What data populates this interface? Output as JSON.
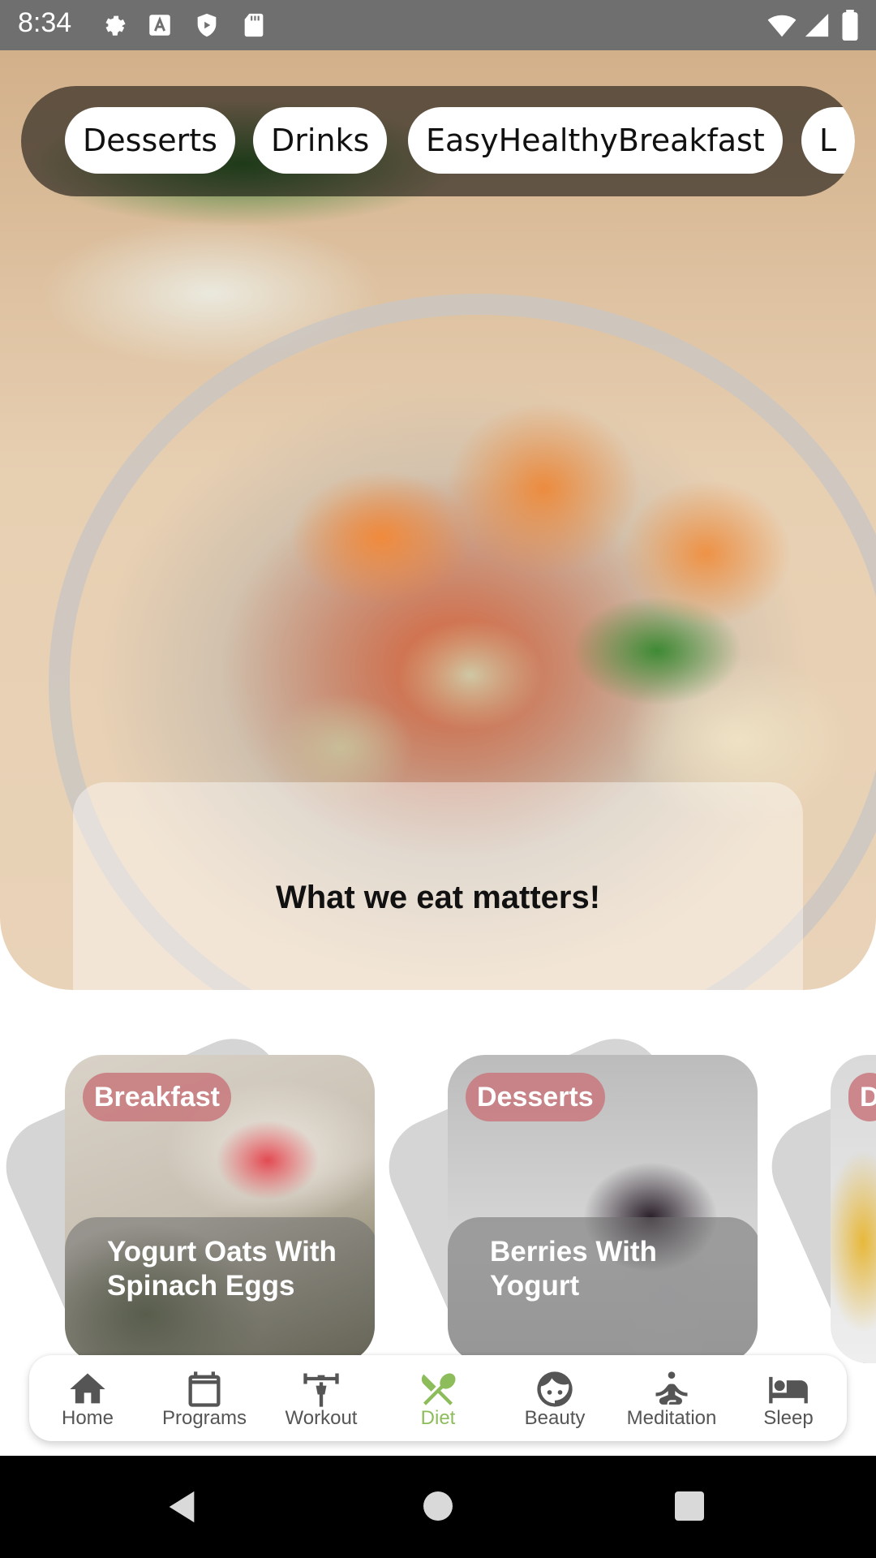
{
  "status_bar": {
    "time": "8:34",
    "icons": [
      "settings-icon",
      "font-a-icon",
      "shield-icon",
      "sd-card-icon",
      "wifi-icon",
      "signal-icon",
      "battery-icon"
    ]
  },
  "hero": {
    "chips": [
      "Desserts",
      "Drinks",
      "EasyHealthyBreakfast",
      "L"
    ],
    "tagline": "What we eat matters!"
  },
  "recipes": [
    {
      "tag": "Breakfast",
      "title": "Yogurt Oats With Spinach Eggs"
    },
    {
      "tag": "Desserts",
      "title": "Berries With Yogurt"
    },
    {
      "tag": "D",
      "title": ""
    }
  ],
  "bottom_nav": {
    "active": "Diet",
    "active_color": "#8dbd5b",
    "items": [
      {
        "label": "Home",
        "icon": "home-icon"
      },
      {
        "label": "Programs",
        "icon": "calendar-icon"
      },
      {
        "label": "Workout",
        "icon": "weightlifter-icon"
      },
      {
        "label": "Diet",
        "icon": "fork-knife-icon"
      },
      {
        "label": "Beauty",
        "icon": "face-icon"
      },
      {
        "label": "Meditation",
        "icon": "meditation-icon"
      },
      {
        "label": "Sleep",
        "icon": "bed-icon"
      }
    ]
  }
}
